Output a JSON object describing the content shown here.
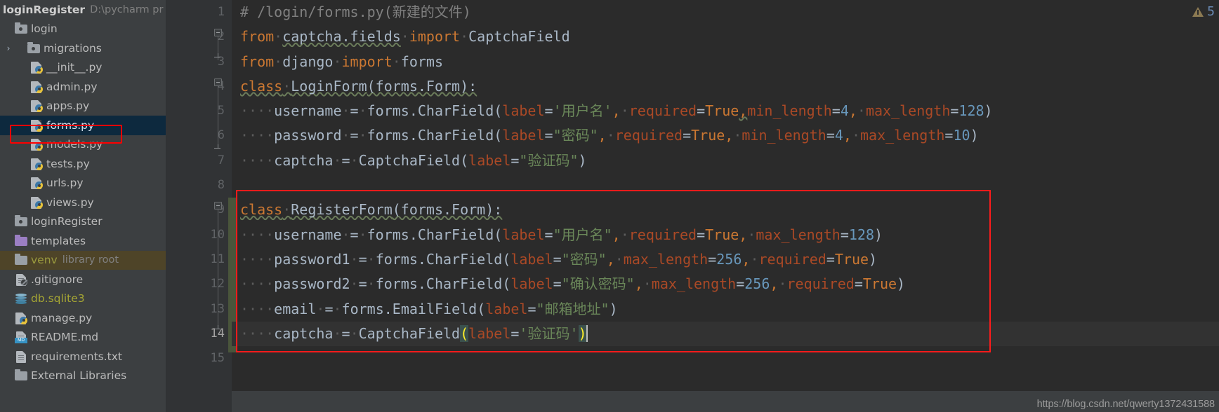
{
  "sidebar": {
    "project_root": {
      "name": "loginRegister",
      "path": "D:\\pycharm pr"
    },
    "items": [
      {
        "label": "login",
        "icon": "folder-icon",
        "indent": 0,
        "arrow": "",
        "type": "folder"
      },
      {
        "label": "migrations",
        "icon": "folder-icon",
        "indent": 1,
        "arrow": "›",
        "type": "folder"
      },
      {
        "label": "__init__.py",
        "icon": "python-file-icon",
        "indent": 2,
        "arrow": "",
        "type": "py"
      },
      {
        "label": "admin.py",
        "icon": "python-file-icon",
        "indent": 2,
        "arrow": "",
        "type": "py"
      },
      {
        "label": "apps.py",
        "icon": "python-file-icon",
        "indent": 2,
        "arrow": "",
        "type": "py"
      },
      {
        "label": "forms.py",
        "icon": "python-file-icon",
        "indent": 2,
        "arrow": "",
        "type": "py",
        "selected": true
      },
      {
        "label": "models.py",
        "icon": "python-file-icon",
        "indent": 2,
        "arrow": "",
        "type": "py"
      },
      {
        "label": "tests.py",
        "icon": "python-file-icon",
        "indent": 2,
        "arrow": "",
        "type": "py"
      },
      {
        "label": "urls.py",
        "icon": "python-file-icon",
        "indent": 2,
        "arrow": "",
        "type": "py"
      },
      {
        "label": "views.py",
        "icon": "python-file-icon",
        "indent": 2,
        "arrow": "",
        "type": "py"
      },
      {
        "label": "loginRegister",
        "icon": "folder-icon",
        "indent": 0,
        "arrow": "",
        "type": "folder"
      },
      {
        "label": "templates",
        "icon": "folder-purple-icon",
        "indent": 0,
        "arrow": "",
        "type": "folder-purple"
      },
      {
        "label": "venv",
        "sublabel": "library root",
        "icon": "folder-icon",
        "indent": 0,
        "arrow": "",
        "type": "venv"
      },
      {
        "label": ".gitignore",
        "icon": "gitignore-file-icon",
        "indent": 0,
        "arrow": "",
        "type": "git"
      },
      {
        "label": "db.sqlite3",
        "icon": "database-icon",
        "indent": 0,
        "arrow": "",
        "type": "db"
      },
      {
        "label": "manage.py",
        "icon": "python-file-icon",
        "indent": 0,
        "arrow": "",
        "type": "py"
      },
      {
        "label": "README.md",
        "icon": "markdown-file-icon",
        "indent": 0,
        "arrow": "",
        "type": "md"
      },
      {
        "label": "requirements.txt",
        "icon": "text-file-icon",
        "indent": 0,
        "arrow": "",
        "type": "txt"
      },
      {
        "label": "External Libraries",
        "icon": "library-icon",
        "indent": 0,
        "arrow": "",
        "type": "lib"
      }
    ]
  },
  "editor": {
    "line_numbers": [
      "1",
      "2",
      "3",
      "4",
      "5",
      "6",
      "7",
      "8",
      "9",
      "10",
      "11",
      "12",
      "13",
      "14",
      "15"
    ],
    "current_line": "14",
    "lines": [
      {
        "n": 1,
        "text": "# /login/forms.py(新建的文件)"
      },
      {
        "n": 2,
        "text": "from captcha.fields import CaptchaField"
      },
      {
        "n": 3,
        "text": "from django import forms"
      },
      {
        "n": 4,
        "text": "class LoginForm(forms.Form):"
      },
      {
        "n": 5,
        "text": "    username = forms.CharField(label='用户名', required=True,min_length=4, max_length=128)"
      },
      {
        "n": 6,
        "text": "    password = forms.CharField(label=\"密码\", required=True, min_length=4, max_length=10)"
      },
      {
        "n": 7,
        "text": "    captcha = CaptchaField(label=\"验证码\")"
      },
      {
        "n": 8,
        "text": ""
      },
      {
        "n": 9,
        "text": "class RegisterForm(forms.Form):"
      },
      {
        "n": 10,
        "text": "    username = forms.CharField(label=\"用户名\", required=True, max_length=128)"
      },
      {
        "n": 11,
        "text": "    password1 = forms.CharField(label=\"密码\", max_length=256, required=True)"
      },
      {
        "n": 12,
        "text": "    password2 = forms.CharField(label=\"确认密码\", max_length=256, required=True)"
      },
      {
        "n": 13,
        "text": "    email = forms.EmailField(label=\"邮箱地址\")"
      },
      {
        "n": 14,
        "text": "    captcha = CaptchaField(label='验证码')"
      },
      {
        "n": 15,
        "text": ""
      }
    ],
    "tokens": {
      "l1_comment": "# /login/forms.py(新建的文件)",
      "kw_from": "from",
      "kw_import": "import",
      "kw_class": "class",
      "mod_captcha_fields": "captcha.fields",
      "name_CaptchaField": "CaptchaField",
      "mod_django": "django",
      "name_forms": "forms",
      "cls_LoginForm": "LoginForm",
      "cls_RegisterForm": "RegisterForm",
      "base_formsForm": "(forms.Form):",
      "f_username": "username",
      "f_password": "password",
      "f_password1": "password1",
      "f_password2": "password2",
      "f_email": "email",
      "f_captcha": "captcha",
      "eq": "=",
      "call_CharField": "forms.CharField(",
      "call_EmailField": "forms.EmailField(",
      "call_CaptchaField": "CaptchaField(",
      "kwarg_label": "label",
      "kwarg_required": "required",
      "kwarg_min_length": "min_length",
      "kwarg_max_length": "max_length",
      "val_True": "True",
      "s_username_sq": "'用户名'",
      "s_username_dq": "\"用户名\"",
      "s_password_dq": "\"密码\"",
      "s_captcha_dq": "\"验证码\"",
      "s_captcha_sq": "'验证码'",
      "s_confirm_pw": "\"确认密码\"",
      "s_email_addr": "\"邮箱地址\"",
      "n_4": "4",
      "n_10": "10",
      "n_128": "128",
      "n_256": "256",
      "paren_close": ")",
      "comma": ",",
      "space_dot": "·"
    }
  },
  "warning": {
    "count": "5",
    "icon": "warning-triangle-icon"
  },
  "watermark": {
    "text": "https://blog.csdn.net/qwerty1372431588"
  },
  "colors": {
    "editor_bg": "#2b2b2b",
    "sidebar_bg": "#3c3f41",
    "gutter_bg": "#313335",
    "selection_bg": "#0d293e",
    "annotation_red": "#ff1b1b",
    "keyword": "#cc7832",
    "string": "#6a8759",
    "number": "#6897bb",
    "kwarg": "#aa4926",
    "comment": "#808080",
    "default_text": "#a9b7c6",
    "changebar_green": "#49553b"
  }
}
